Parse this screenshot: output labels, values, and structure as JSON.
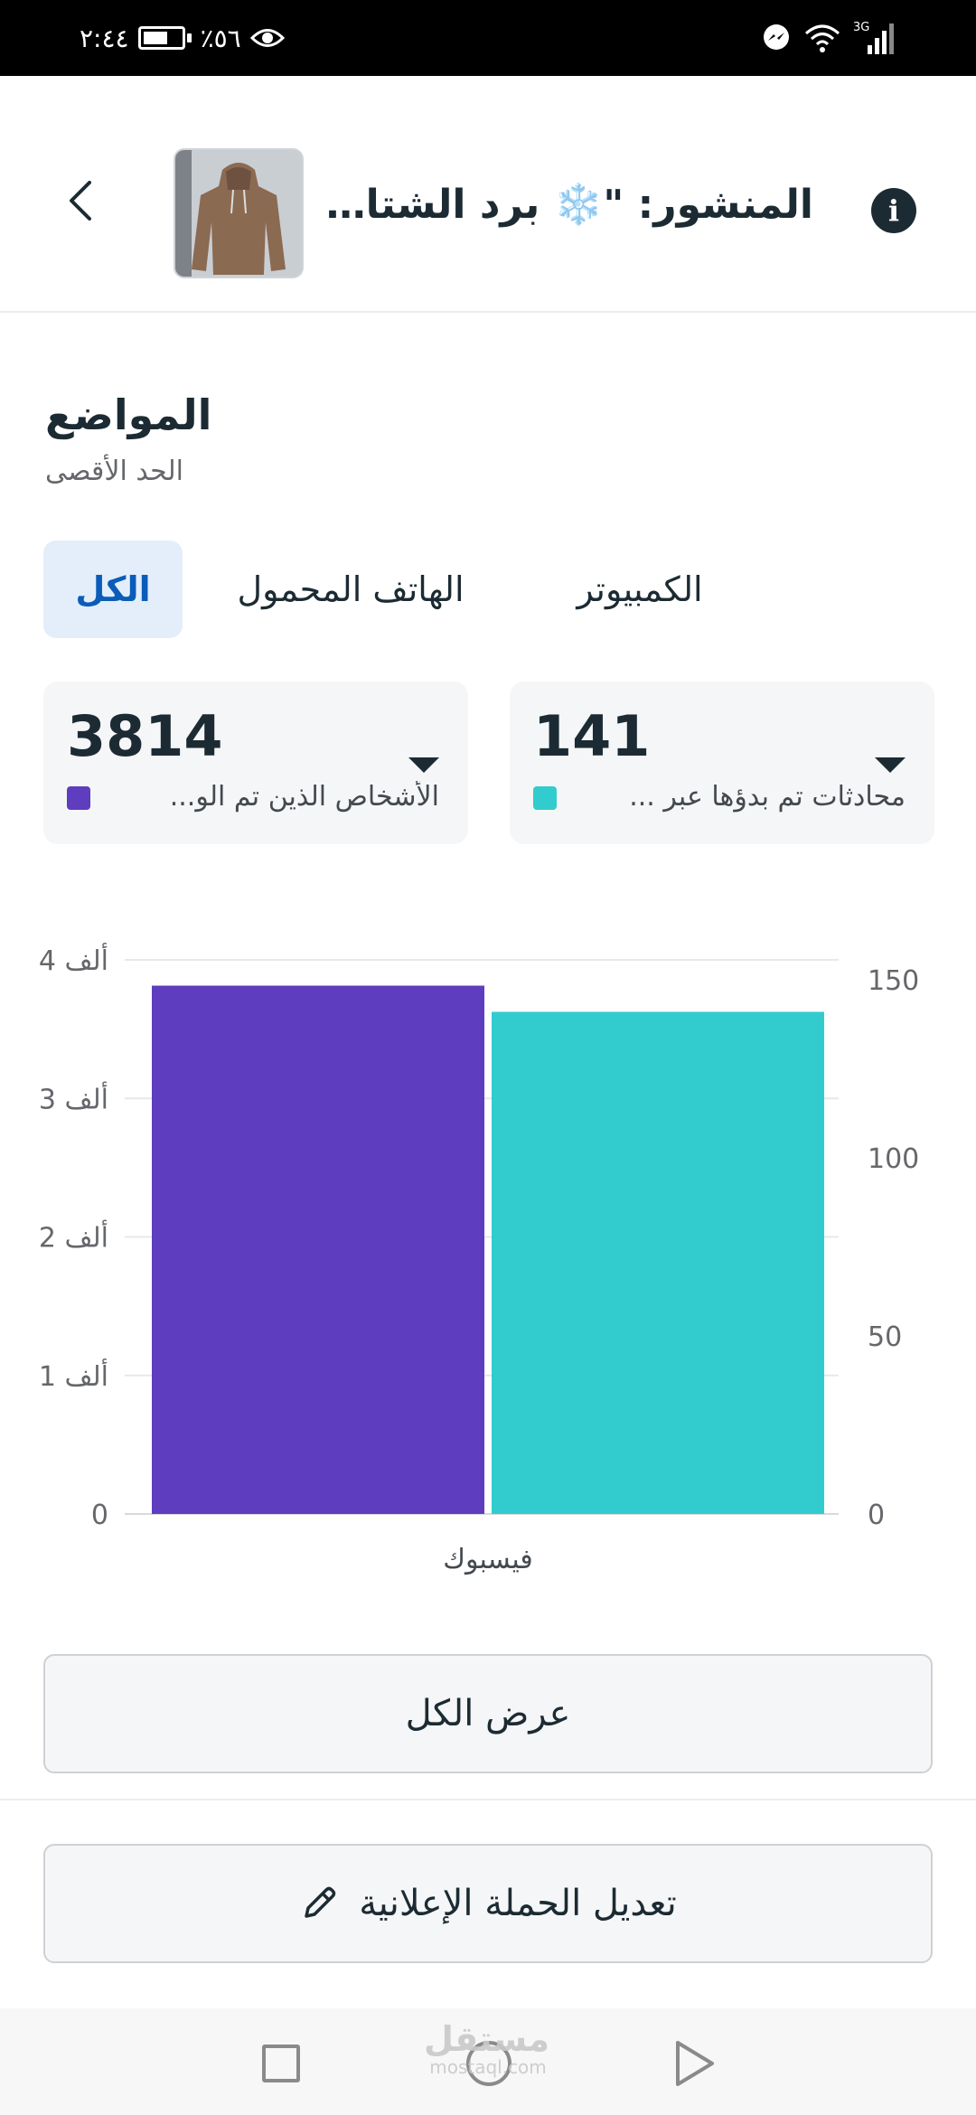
{
  "status_bar": {
    "time": "٢:٤٤",
    "battery": "٪٥٦",
    "network": "3G"
  },
  "header": {
    "post_title": "المنشور: \"❄️ برد الشتاء ...",
    "thumbnail_alt": "hoodie-photo"
  },
  "section": {
    "title": "المواضع",
    "subtitle": "الحد الأقصى"
  },
  "tabs": [
    {
      "label": "الكل",
      "active": true
    },
    {
      "label": "الهاتف المحمول",
      "active": false
    },
    {
      "label": "الكمبيوتر",
      "active": false
    }
  ],
  "metrics": [
    {
      "value": "3814",
      "label": "الأشخاص الذين تم الو...",
      "color": "#5e3dbe"
    },
    {
      "value": "141",
      "label": "محادثات تم بدؤها عبر ...",
      "color": "#32ccce"
    }
  ],
  "chart_data": {
    "type": "bar",
    "categories": [
      "فيسبوك"
    ],
    "series": [
      {
        "values": [
          3814
        ],
        "color": "#5e3dbe",
        "axis": "left"
      },
      {
        "values": [
          141
        ],
        "color": "#32ccce",
        "axis": "right"
      }
    ],
    "left_axis": {
      "ylim": [
        0,
        4000
      ],
      "ticks": [
        "0",
        "1 ألف",
        "2 ألف",
        "3 ألف",
        "4 ألف"
      ]
    },
    "right_axis": {
      "ylim": [
        0,
        150
      ],
      "ticks": [
        "0",
        "50",
        "100",
        "150"
      ]
    },
    "grid": true
  },
  "buttons": {
    "view_all": "عرض الكل",
    "edit_campaign": "تعديل الحملة الإعلانية"
  },
  "watermark": {
    "arabic": "مستقل",
    "latin": "mostaql.com"
  }
}
